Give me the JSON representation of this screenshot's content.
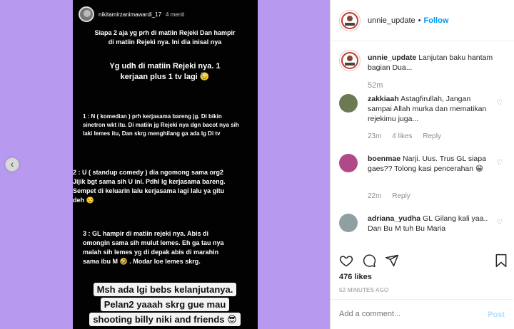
{
  "story": {
    "username": "nikitamirzanimawardi_17",
    "time": "4 menit",
    "lines": {
      "intro1": "Siapa 2 aja yg prh di matiin Rejeki Dan hampir",
      "intro2": "di matiin Rejeki nya. Ini dia inisal nya",
      "headline1": "Yg udh di matiin Rejeki nya.  1",
      "headline2": "kerjaan plus 1 tv lagi 😓",
      "p1_1": "1 : N ( komedian ) prh kerjasama bareng jg. Di bikin",
      "p1_2": "sinetron wkt itu. Di matiin jg Rejeki nya dgn bacot nya sih",
      "p1_3": "laki lemes itu,  Dan skrg menghilang ga ada lg Di tv",
      "p2_1": "2 : U ( standup comedy ) dia ngomong sama org2",
      "p2_2": "Jijik bgt sama sih U ini. Pdhl lg kerjasama bareng.",
      "p2_3": "Sempet di keluarin lalu kerjasama lagi lalu ya gitu",
      "p2_4": "deh 😒",
      "p3_1": "3 : GL hampir di matiin rejeki nya. Abis di",
      "p3_2": "omongin sama sih mulut lemes. Eh ga tau nya",
      "p3_3": "malah sih lemes yg di depak abis di marahin",
      "p3_4": "sama ibu M 🤣 . Modar loe lemes skrg."
    },
    "highlights": [
      "Msh ada lgi bebs kelanjutanya.",
      "Pelan2 yaaah skrg gue mau",
      "shooting billy niki and friends 😎"
    ]
  },
  "sidebar": {
    "header": {
      "username": "unnie_update",
      "dot": "•",
      "follow": "Follow"
    },
    "caption": {
      "username": "unnie_update",
      "text": "Lanjutan baku hantam bagian Dua...",
      "time": "52m"
    },
    "comments": [
      {
        "username": "zakkiaah",
        "text": "Astagfirullah, Jangan sampai Allah murka dan mematikan rejekimu juga...",
        "time": "23m",
        "likes": "4 likes",
        "reply": "Reply",
        "avatar_color": "#6b7a55"
      },
      {
        "username": "boenmae",
        "text": "Narji. Uus. Trus GL siapa gaes?? Tolong kasi pencerahan 😁",
        "time": "22m",
        "likes": "",
        "reply": "Reply",
        "avatar_color": "#b04a86"
      },
      {
        "username": "adriana_yudha",
        "text": "GL Gilang kali yaa.. Dan Bu M tuh Bu Maria",
        "time": "",
        "likes": "",
        "reply": "",
        "avatar_color": "#8fa0a3"
      }
    ],
    "likes_count": "476 likes",
    "posted_ago": "52 MINUTES AGO",
    "add_comment_placeholder": "Add a comment...",
    "post_label": "Post"
  },
  "colors": {
    "media_bg": "#b79af0",
    "link_blue": "#0095f6"
  },
  "icons": [
    "chevron-left-icon",
    "heart-icon",
    "comment-icon",
    "share-icon",
    "bookmark-icon"
  ]
}
